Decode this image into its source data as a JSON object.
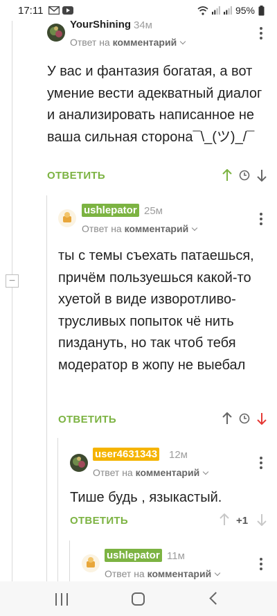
{
  "status_bar": {
    "time": "17:11",
    "battery": "95%"
  },
  "colors": {
    "accent_green": "#7cb342",
    "badge_orange": "#f5b400",
    "downvote_red": "#e53935",
    "upvote_green": "#7cb342"
  },
  "comments": [
    {
      "author": "YourShining",
      "time": "34м",
      "reply_prefix": "Ответ на",
      "reply_target": "комментарий",
      "text": "У вас и фантазия богатая, а вот умение вести адекватный диалог и анализировать написанное не ваша сильная сторона¯\\_(ツ)_/¯",
      "reply_label": "ОТВЕТИТЬ",
      "vote_state": "upvoted"
    },
    {
      "author": "ushlepator",
      "time": "25м",
      "reply_prefix": "Ответ на",
      "reply_target": "комментарий",
      "text": "ты с темы съехать патаешься, причём пользуешься какой-то хуетой в виде изворотливо-трусливых попыток чё нить пиздануть, но так чтоб тебя модератор в жопу не выебал",
      "reply_label": "ОТВЕТИТЬ",
      "vote_state": "downvoted"
    },
    {
      "author": "user4631343",
      "time": "12м",
      "reply_prefix": "Ответ на",
      "reply_target": "комментарий",
      "text": "Тише будь , языкастый.",
      "reply_label": "ОТВЕТИТЬ",
      "rating": "+1"
    },
    {
      "author": "ushlepator",
      "time": "11м",
      "reply_prefix": "Ответ на",
      "reply_target": "комментарий"
    }
  ],
  "icons": {
    "upvote": "arrow-up-icon",
    "downvote": "arrow-down-icon",
    "save": "clock-icon",
    "menu": "more-vert-icon",
    "collapse": "minus-icon"
  }
}
